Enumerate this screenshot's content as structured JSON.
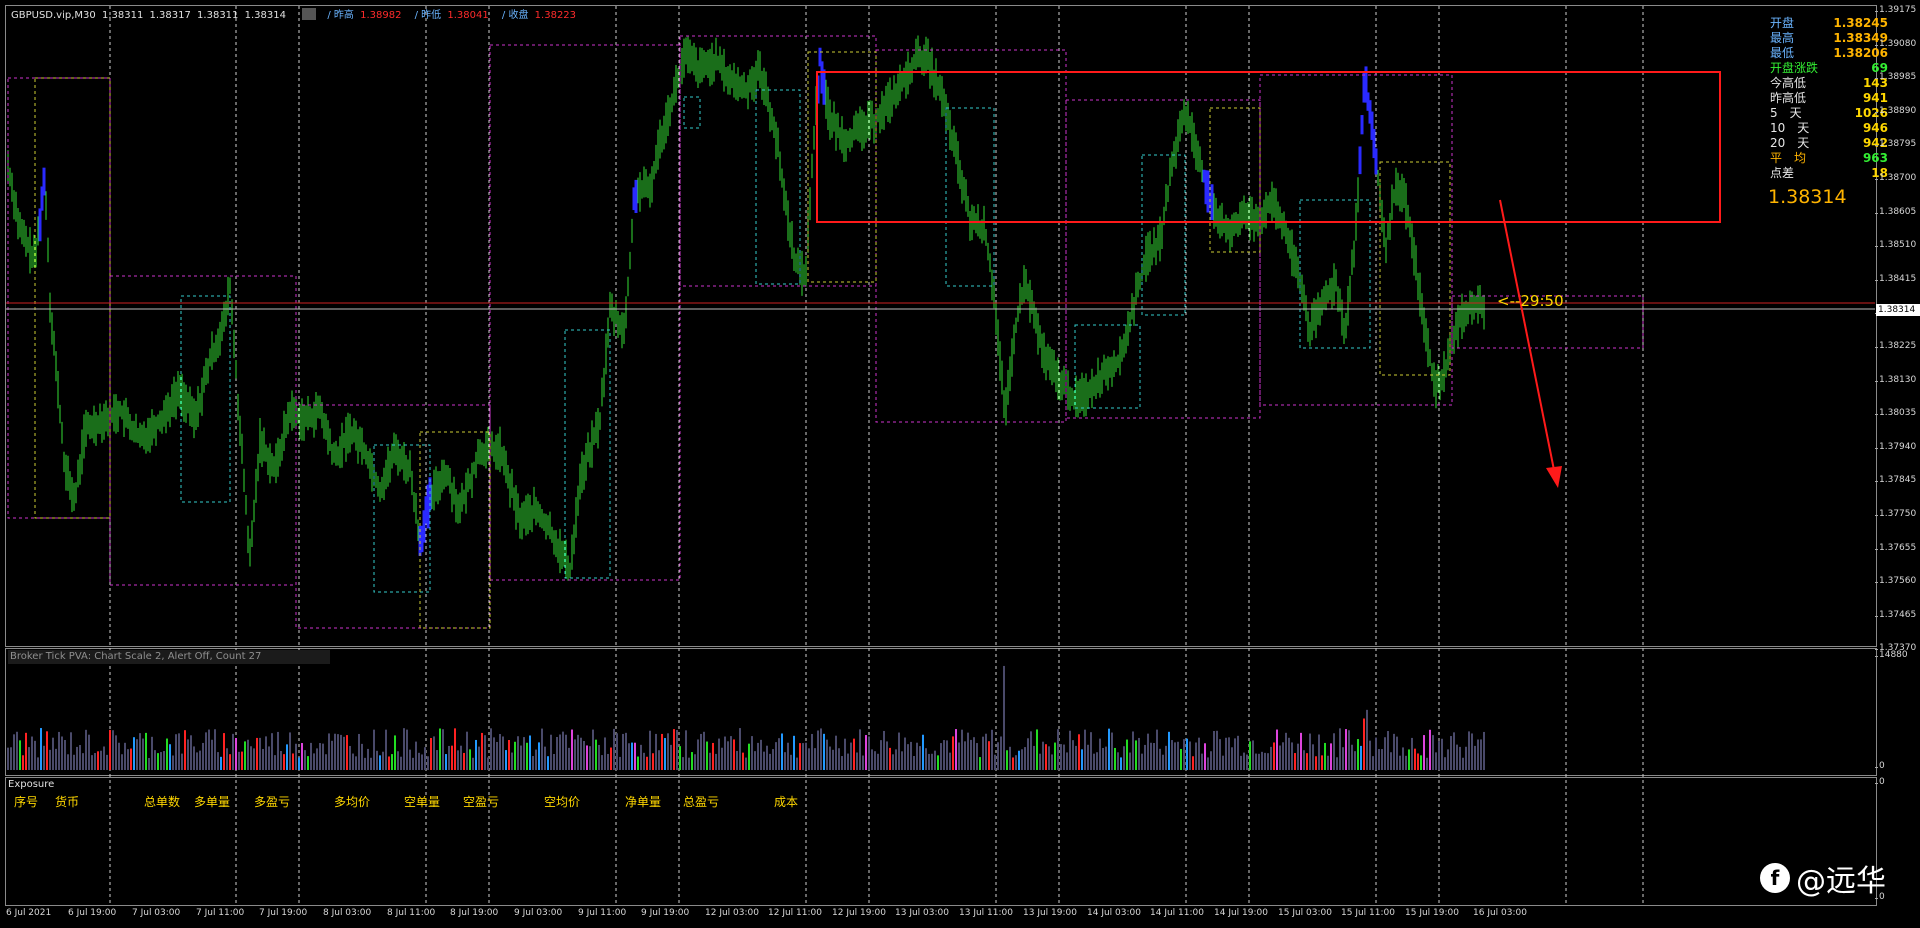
{
  "symbol": {
    "name": "GBPUSD.vip,M30",
    "ohlc": [
      "1.38311",
      "1.38317",
      "1.38311",
      "1.38314"
    ]
  },
  "header": {
    "prev_high_label": "/ 昨高",
    "prev_high": "1.38982",
    "prev_low_label": "/ 昨低",
    "prev_low": "1.38041",
    "prev_close_label": "/ 收盘",
    "prev_close": "1.38223"
  },
  "stats": [
    {
      "label": "开盘",
      "value": "1.38245",
      "lc": "#6ab4ff",
      "vc": "#ffb400"
    },
    {
      "label": "最高",
      "value": "1.38349",
      "lc": "#6ab4ff",
      "vc": "#ffb400"
    },
    {
      "label": "最低",
      "value": "1.38206",
      "lc": "#6ab4ff",
      "vc": "#ffb400"
    },
    {
      "label": "开盘涨跌",
      "value": "69",
      "lc": "#33ee33",
      "vc": "#33ee33"
    },
    {
      "label": "今高低",
      "value": "143",
      "lc": "#e6e6e6",
      "vc": "#ffd700"
    },
    {
      "label": "昨高低",
      "value": "941",
      "lc": "#e6e6e6",
      "vc": "#ffd700"
    },
    {
      "label": "5　天",
      "value": "1026",
      "lc": "#e6e6e6",
      "vc": "#ffd700"
    },
    {
      "label": "10　天",
      "value": "946",
      "lc": "#e6e6e6",
      "vc": "#ffd700"
    },
    {
      "label": "20　天",
      "value": "942",
      "lc": "#e6e6e6",
      "vc": "#ffd700"
    },
    {
      "label": "平　均",
      "value": "963",
      "lc": "#ffb400",
      "vc": "#33ee33"
    },
    {
      "label": "点差",
      "value": "18",
      "lc": "#e6e6e6",
      "vc": "#ffd700"
    }
  ],
  "current_price": "1.38314",
  "countdown": "<--29:50",
  "price_axis": [
    "1.39175",
    "1.39080",
    "1.38985",
    "1.38890",
    "1.38795",
    "1.38700",
    "1.38605",
    "1.38510",
    "1.38415",
    "1.38320",
    "1.38225",
    "1.38130",
    "1.38035",
    "1.37940",
    "1.37845",
    "1.37750",
    "1.37655",
    "1.37560",
    "1.37465",
    "1.37370"
  ],
  "price_marker": "1.38314",
  "time_axis": [
    "6 Jul 2021",
    "6 Jul 19:00",
    "7 Jul 03:00",
    "7 Jul 11:00",
    "7 Jul 19:00",
    "8 Jul 03:00",
    "8 Jul 11:00",
    "8 Jul 19:00",
    "9 Jul 03:00",
    "9 Jul 11:00",
    "9 Jul 19:00",
    "12 Jul 03:00",
    "12 Jul 11:00",
    "12 Jul 19:00",
    "13 Jul 03:00",
    "13 Jul 11:00",
    "13 Jul 19:00",
    "14 Jul 03:00",
    "14 Jul 11:00",
    "14 Jul 19:00",
    "15 Jul 03:00",
    "15 Jul 11:00",
    "15 Jul 19:00",
    "16 Jul 03:00"
  ],
  "volume_indicator": {
    "caption": "Broker Tick PVA:   Chart Scale  2,  Alert Off,  Count  27",
    "axis_top": "14880",
    "axis_bottom": "0"
  },
  "exposure": {
    "caption": "Exposure",
    "headers": [
      "序号",
      "货币",
      "总单数",
      "多单量",
      "多盈亏",
      "多均价",
      "空单量",
      "空盈亏",
      "空均价",
      "净单量",
      "总盈亏",
      "成本"
    ],
    "axis_top": "0",
    "axis_bottom": "0"
  },
  "watermark": {
    "logo": "f",
    "text": "@远华"
  }
}
